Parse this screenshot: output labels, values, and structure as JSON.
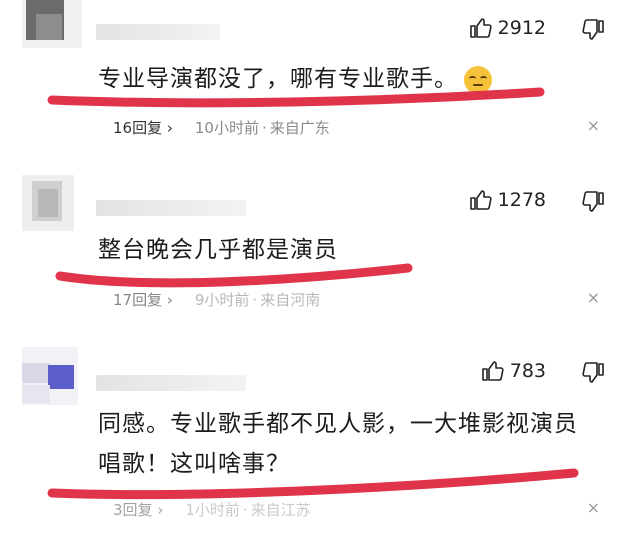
{
  "comments": [
    {
      "likes": "2912",
      "text": "专业导演都没了，哪有专业歌手。",
      "emoji": "pensive-face-emoji",
      "replies": "16回复",
      "reply_arrow": "›",
      "time": "10小时前",
      "separator": "·",
      "place": "来自广东",
      "close": "×"
    },
    {
      "likes": "1278",
      "text": "整台晚会几乎都是演员",
      "replies": "17回复",
      "reply_arrow": "›",
      "time": "9小时前",
      "separator": "·",
      "place": "来自河南",
      "close": "×"
    },
    {
      "likes": "783",
      "text_line1": "同感。专业歌手都不见人影，一大堆影视演员",
      "text_line2": "唱歌！这叫啥事？",
      "replies": "3回复",
      "reply_arrow": "›",
      "time": "1小时前",
      "separator": "·",
      "place": "来自江苏",
      "close": "×"
    }
  ],
  "colors": {
    "underline": "#e0344a",
    "text": "#1c1c1c",
    "meta": "#8a8a8a",
    "avatar_blue": "#5c5fc9"
  },
  "icons": [
    "thumbs-up-icon",
    "thumbs-down-icon",
    "close-icon",
    "chevron-right-icon"
  ]
}
